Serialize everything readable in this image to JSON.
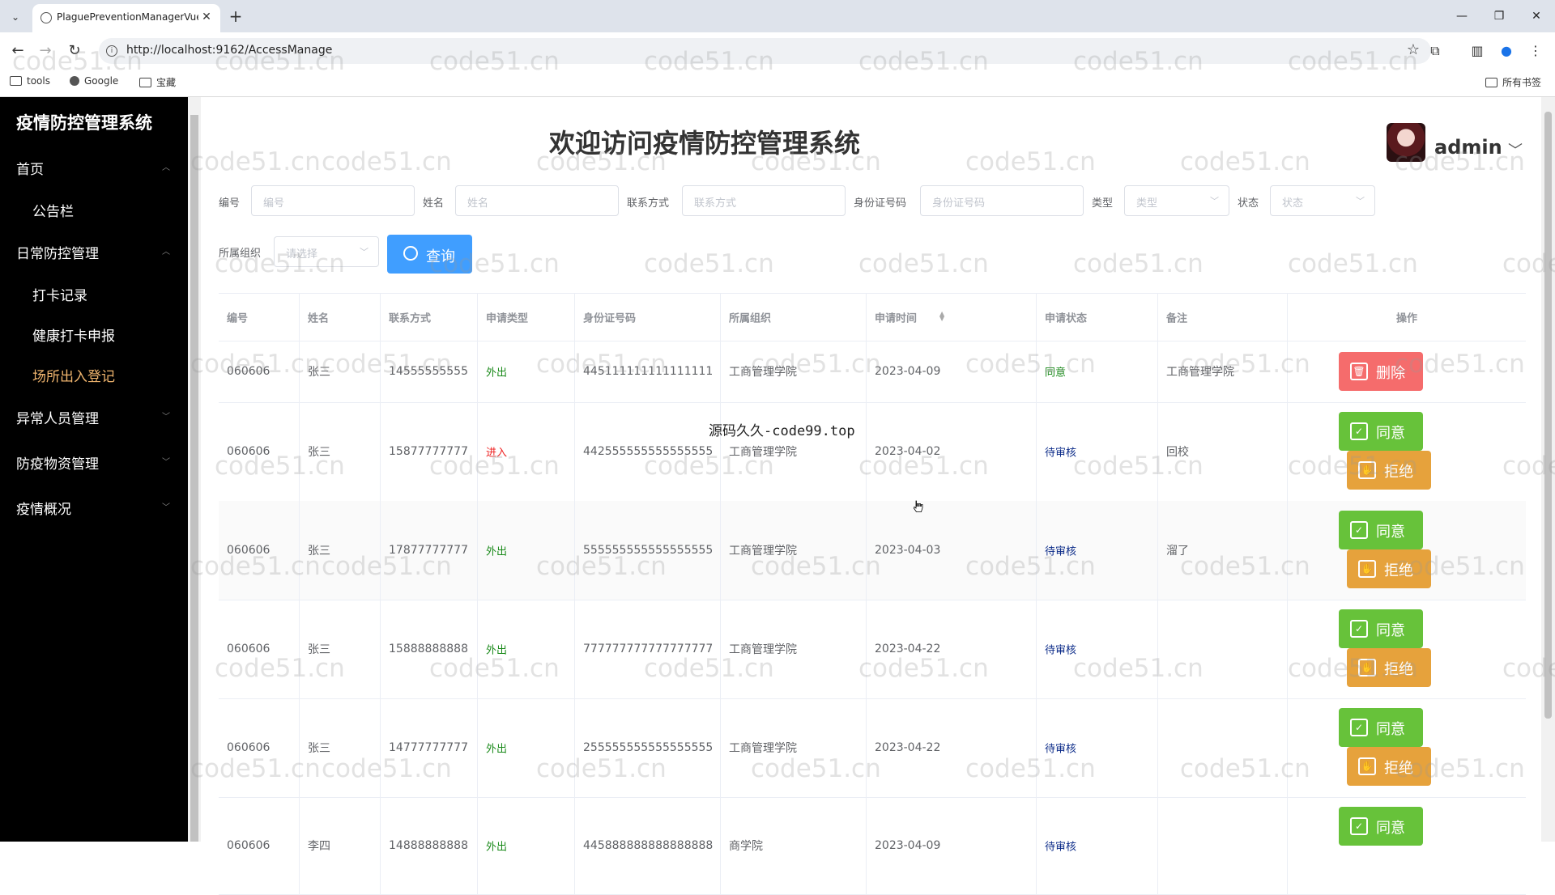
{
  "browser": {
    "tab_title": "PlaguePreventionManagerVue",
    "url": "http://localhost:9162/AccessManage",
    "bookmarks": [
      "tools",
      "Google",
      "宝藏"
    ],
    "all_bookmarks": "所有书签"
  },
  "sidebar": {
    "brand": "疫情防控管理系统",
    "items": [
      {
        "label": "首页",
        "expanded": true,
        "children": [
          {
            "label": "公告栏"
          }
        ]
      },
      {
        "label": "日常防控管理",
        "expanded": true,
        "children": [
          {
            "label": "打卡记录"
          },
          {
            "label": "健康打卡申报"
          },
          {
            "label": "场所出入登记",
            "active": true
          }
        ]
      },
      {
        "label": "异常人员管理",
        "expanded": false
      },
      {
        "label": "防疫物资管理",
        "expanded": false
      },
      {
        "label": "疫情概况",
        "expanded": false
      }
    ]
  },
  "header": {
    "title": "欢迎访问疫情防控管理系统",
    "user": "admin"
  },
  "filters": {
    "id": {
      "label": "编号",
      "placeholder": "编号"
    },
    "name": {
      "label": "姓名",
      "placeholder": "姓名"
    },
    "contact": {
      "label": "联系方式",
      "placeholder": "联系方式"
    },
    "idcard": {
      "label": "身份证号码",
      "placeholder": "身份证号码"
    },
    "type": {
      "label": "类型",
      "placeholder": "类型"
    },
    "status": {
      "label": "状态",
      "placeholder": "状态"
    },
    "org": {
      "label": "所属组织",
      "placeholder": "请选择"
    },
    "query_label": "查询"
  },
  "table": {
    "headers": [
      "编号",
      "姓名",
      "联系方式",
      "申请类型",
      "身份证号码",
      "所属组织",
      "申请时间",
      "申请状态",
      "备注",
      "操作"
    ],
    "rows": [
      {
        "id": "060606",
        "name": "张三",
        "phone": "14555555555",
        "type": "外出",
        "idcard": "445111111111111111",
        "org": "工商管理学院",
        "time": "2023-04-09",
        "status": "同意",
        "note": "工商管理学院"
      },
      {
        "id": "060606",
        "name": "张三",
        "phone": "15877777777",
        "type": "进入",
        "idcard": "442555555555555555",
        "org": "工商管理学院",
        "time": "2023-04-02",
        "status": "待审核",
        "note": "回校"
      },
      {
        "id": "060606",
        "name": "张三",
        "phone": "17877777777",
        "type": "外出",
        "idcard": "555555555555555555",
        "org": "工商管理学院",
        "time": "2023-04-03",
        "status": "待审核",
        "note": "溜了"
      },
      {
        "id": "060606",
        "name": "张三",
        "phone": "15888888888",
        "type": "外出",
        "idcard": "777777777777777777",
        "org": "工商管理学院",
        "time": "2023-04-22",
        "status": "待审核",
        "note": ""
      },
      {
        "id": "060606",
        "name": "张三",
        "phone": "14777777777",
        "type": "外出",
        "idcard": "255555555555555555",
        "org": "工商管理学院",
        "time": "2023-04-22",
        "status": "待审核",
        "note": ""
      },
      {
        "id": "060606",
        "name": "李四",
        "phone": "14888888888",
        "type": "外出",
        "idcard": "445888888888888888",
        "org": "商学院",
        "time": "2023-04-09",
        "status": "待审核",
        "note": ""
      }
    ],
    "actions": {
      "delete": "删除",
      "agree": "同意",
      "reject": "拒绝"
    }
  },
  "watermark": "code51.cn",
  "overlay": "源码久久-code99.top",
  "colors": {
    "sidebar_bg": "#000000",
    "active_menu": "#f0b56e",
    "primary": "#409eff",
    "agree": "#67c23a",
    "reject": "#e6a23c",
    "delete": "#f56c6c"
  }
}
